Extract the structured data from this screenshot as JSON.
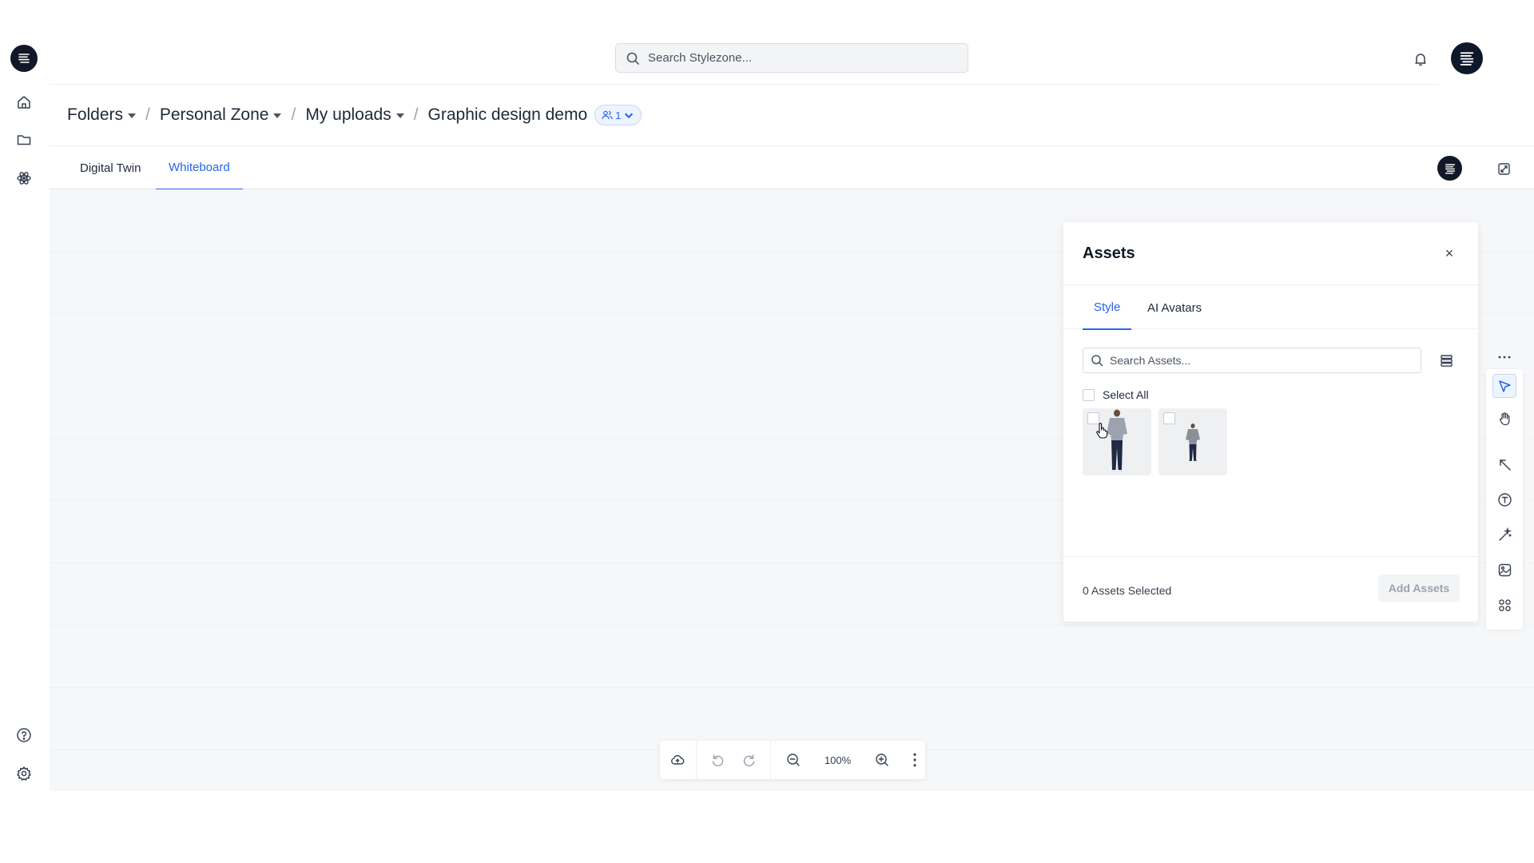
{
  "sidebar": {
    "items": [
      {
        "name": "home",
        "icon": "home-icon"
      },
      {
        "name": "folders",
        "icon": "folder-icon"
      },
      {
        "name": "atom",
        "icon": "atom-icon"
      },
      {
        "name": "help",
        "icon": "help-icon"
      },
      {
        "name": "settings",
        "icon": "gear-icon"
      }
    ]
  },
  "header": {
    "search_placeholder": "Search Stylezone..."
  },
  "breadcrumb": {
    "items": [
      "Folders",
      "Personal Zone",
      "My uploads"
    ],
    "current": "Graphic design demo",
    "separator": "/",
    "member_count": "1"
  },
  "tabs": {
    "items": [
      "Digital Twin",
      "Whiteboard"
    ],
    "active": "Whiteboard"
  },
  "assets_panel": {
    "title": "Assets",
    "close_label": "×",
    "tabs": [
      "Style",
      "AI Avatars"
    ],
    "active_tab": "Style",
    "search_placeholder": "Search Assets...",
    "select_all_label": "Select All",
    "thumbnails": [
      {
        "name": "asset-1",
        "selected": false
      },
      {
        "name": "asset-2",
        "selected": false
      }
    ],
    "selected_count_text": "0 Assets Selected",
    "add_button_label": "Add Assets"
  },
  "toolbar": {
    "zoom_level": "100%"
  },
  "colors": {
    "accent": "#2563eb",
    "dark": "#111827",
    "canvas": "#f6f7f9"
  }
}
